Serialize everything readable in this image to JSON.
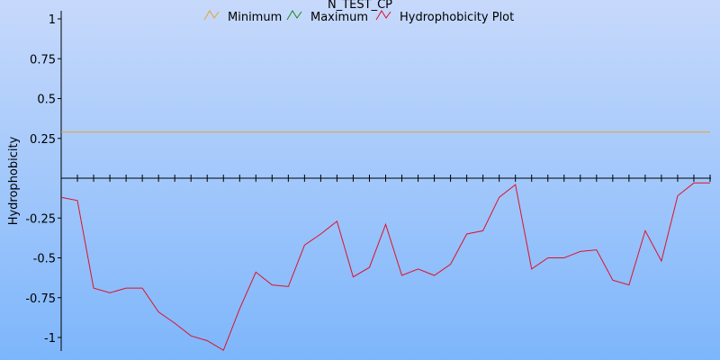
{
  "chart_data": {
    "type": "line",
    "title": "N_TEST_CP",
    "xlabel": "",
    "ylabel": "Hydrophobicity",
    "ylim": [
      -1.07,
      1.02
    ],
    "xlim": [
      0,
      40
    ],
    "grid": false,
    "legend_position": "top-center",
    "yticks": [
      1,
      0.75,
      0.5,
      0.25,
      -0.25,
      -0.5,
      -0.75,
      -1
    ],
    "ytick_labels": [
      "1",
      "0.75",
      "0.5",
      "0.25",
      "-0.25",
      "-0.5",
      "-0.75",
      "-1"
    ],
    "xtick_count": 40,
    "series": [
      {
        "name": "Minimum",
        "color": "#e8a12e",
        "x": [
          0,
          40
        ],
        "values": [
          0.29,
          0.29
        ]
      },
      {
        "name": "Maximum",
        "color": "#1a8a1a",
        "x": [],
        "values": []
      },
      {
        "name": "Hydrophobicity Plot",
        "color": "#e0102a",
        "x": [
          0,
          1,
          2,
          3,
          4,
          5,
          6,
          7,
          8,
          9,
          10,
          11,
          12,
          13,
          14,
          15,
          16,
          17,
          18,
          19,
          20,
          21,
          22,
          23,
          24,
          25,
          26,
          27,
          28,
          29,
          30,
          31,
          32,
          33,
          34,
          35,
          36,
          37,
          38,
          39,
          40
        ],
        "values": [
          -0.12,
          -0.14,
          -0.69,
          -0.72,
          -0.69,
          -0.69,
          -0.84,
          -0.91,
          -0.99,
          -1.02,
          -1.08,
          -0.82,
          -0.59,
          -0.67,
          -0.68,
          -0.42,
          -0.35,
          -0.27,
          -0.62,
          -0.56,
          -0.29,
          -0.61,
          -0.57,
          -0.61,
          -0.54,
          -0.35,
          -0.33,
          -0.12,
          -0.04,
          -0.57,
          -0.5,
          -0.5,
          -0.46,
          -0.45,
          -0.64,
          -0.67,
          -0.33,
          -0.52,
          -0.11,
          -0.03,
          -0.03
        ]
      }
    ]
  },
  "colors": {
    "background_top": "#c7d9fb",
    "background_bottom": "#7db6fb",
    "axis": "#000000"
  }
}
